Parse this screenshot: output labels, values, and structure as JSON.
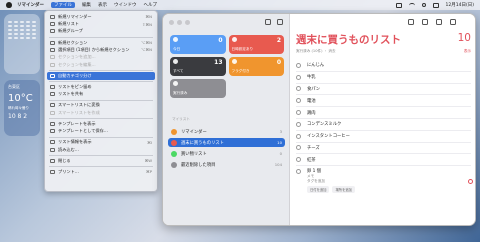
{
  "menubar": {
    "app": "リマインダー",
    "items": [
      "ファイル",
      "編集",
      "表示",
      "ウインドウ",
      "ヘルプ"
    ],
    "time": "12月14日(日)"
  },
  "file_menu": [
    {
      "label": "新規リマインダー",
      "shortcut": "⌘N",
      "state": "normal"
    },
    {
      "label": "新規リスト",
      "shortcut": "⇧⌘N",
      "state": "normal"
    },
    {
      "label": "新規グループ",
      "shortcut": "",
      "state": "normal"
    },
    {
      "sep": true
    },
    {
      "label": "新規セクション",
      "shortcut": "⌥⌘N",
      "state": "normal"
    },
    {
      "label": "選択項目 (1項目) から新規セクション",
      "shortcut": "⌥⌘N",
      "state": "normal"
    },
    {
      "label": "セクションを追加…",
      "shortcut": "",
      "state": "disabled"
    },
    {
      "label": "セクションを編集…",
      "shortcut": "",
      "state": "disabled"
    },
    {
      "sep": true
    },
    {
      "label": "自動カテゴリ分け",
      "shortcut": "",
      "state": "highlighted"
    },
    {
      "sep": true
    },
    {
      "label": "リストをピン留め",
      "shortcut": "",
      "state": "normal"
    },
    {
      "label": "リストを共有",
      "shortcut": "",
      "state": "normal"
    },
    {
      "sep": true
    },
    {
      "label": "スマートリストに変換",
      "shortcut": "",
      "state": "normal"
    },
    {
      "label": "スマートリストを作成",
      "shortcut": "",
      "state": "disabled"
    },
    {
      "sep": true
    },
    {
      "label": "テンプレートを表示",
      "shortcut": "",
      "state": "normal"
    },
    {
      "label": "テンプレートとして保存…",
      "shortcut": "",
      "state": "normal"
    },
    {
      "sep": true
    },
    {
      "label": "リスト情報を表示",
      "shortcut": "⌘I",
      "state": "normal"
    },
    {
      "label": "読み込む…",
      "shortcut": "",
      "state": "normal"
    },
    {
      "sep": true
    },
    {
      "label": "閉じる",
      "shortcut": "⌘W",
      "state": "normal"
    },
    {
      "sep": true
    },
    {
      "label": "プリント…",
      "shortcut": "⌘P",
      "state": "normal"
    }
  ],
  "widgets": {
    "weather_loc": "台東区",
    "weather_temp": "10°C",
    "weather_desc": "晴れ時々曇り",
    "weather_hilo": "10 8 2"
  },
  "tiles": [
    {
      "label": "今日",
      "count": "0",
      "cls": "t-today"
    },
    {
      "label": "日時設定あり",
      "count": "2",
      "cls": "t-sched"
    },
    {
      "label": "すべて",
      "count": "13",
      "cls": "t-all"
    },
    {
      "label": "フラグ付き",
      "count": "0",
      "cls": "t-flag"
    },
    {
      "label": "実行済み",
      "count": "",
      "cls": "t-done"
    }
  ],
  "lists_header": "マイリスト",
  "lists": [
    {
      "label": "リマインダー",
      "count": "3",
      "color": "#f0952e",
      "selected": false
    },
    {
      "label": "週末に買うものリスト",
      "count": "10",
      "color": "#e85a4f",
      "selected": true
    },
    {
      "label": "買い物リスト",
      "count": "0",
      "color": "#4cd964",
      "selected": false
    },
    {
      "label": "最近削除した項目",
      "count": "104",
      "color": "#8e8e93",
      "selected": false
    }
  ],
  "main": {
    "title": "週末に買うものリスト",
    "count": "10",
    "subtitle": "実行済み (10件) ・ 消去",
    "show": "表示",
    "items": [
      "にんじん",
      "牛乳",
      "食パン",
      "電池",
      "鶏肉",
      "コンデンスミルク",
      "インスタントコーヒー",
      "チーズ",
      "紅茶"
    ],
    "last_item": "卵 1 個",
    "last_notes": [
      "メモ",
      "タグを追加"
    ],
    "chips": [
      "日付を追加",
      "場所を追加"
    ]
  }
}
